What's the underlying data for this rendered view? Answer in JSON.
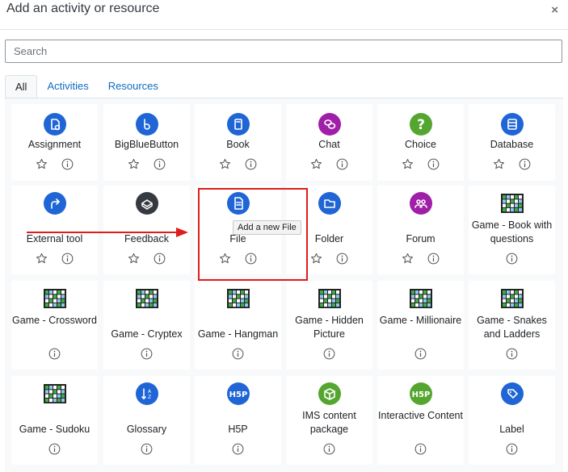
{
  "dialog": {
    "title": "Add an activity or resource",
    "close_glyph": "×"
  },
  "search": {
    "placeholder": "Search",
    "value": ""
  },
  "tabs": [
    {
      "label": "All",
      "active": true
    },
    {
      "label": "Activities",
      "active": false
    },
    {
      "label": "Resources",
      "active": false
    }
  ],
  "tooltip": {
    "text": "Add a new File"
  },
  "tiles": [
    {
      "label": "Assignment",
      "icon": "assignment-icon",
      "color": "#1f65d6",
      "starred": false
    },
    {
      "label": "BigBlueButton",
      "icon": "bigbluebutton-icon",
      "color": "#1f65d6",
      "starred": false
    },
    {
      "label": "Book",
      "icon": "book-icon",
      "color": "#1f65d6",
      "starred": false
    },
    {
      "label": "Chat",
      "icon": "chat-icon",
      "color": "#9f1fa8",
      "starred": false
    },
    {
      "label": "Choice",
      "icon": "choice-icon",
      "color": "#55a630",
      "starred": false
    },
    {
      "label": "Database",
      "icon": "database-icon",
      "color": "#1f65d6",
      "starred": false
    },
    {
      "label": "External tool",
      "icon": "external-tool-icon",
      "color": "#1f65d6",
      "starred": false
    },
    {
      "label": "Feedback",
      "icon": "feedback-icon",
      "color": "#343a40",
      "starred": false
    },
    {
      "label": "File",
      "icon": "file-icon",
      "color": "#1f65d6",
      "starred": false
    },
    {
      "label": "Folder",
      "icon": "folder-icon",
      "color": "#1f65d6",
      "starred": false
    },
    {
      "label": "Forum",
      "icon": "forum-icon",
      "color": "#9f1fa8",
      "starred": false
    },
    {
      "label": "Game - Book with questions",
      "icon": "game-board-icon",
      "color": "#222222",
      "starred": null
    },
    {
      "label": "Game - Crossword",
      "icon": "game-board-icon",
      "color": "#222222",
      "starred": null
    },
    {
      "label": "Game - Cryptex",
      "icon": "game-board-icon",
      "color": "#222222",
      "starred": null
    },
    {
      "label": "Game - Hangman",
      "icon": "game-board-icon",
      "color": "#222222",
      "starred": null
    },
    {
      "label": "Game - Hidden Picture",
      "icon": "game-board-icon",
      "color": "#222222",
      "starred": null
    },
    {
      "label": "Game - Millionaire",
      "icon": "game-board-icon",
      "color": "#222222",
      "starred": null
    },
    {
      "label": "Game - Snakes and Ladders",
      "icon": "game-board-icon",
      "color": "#222222",
      "starred": null
    },
    {
      "label": "Game - Sudoku",
      "icon": "game-board-icon",
      "color": "#222222",
      "starred": null
    },
    {
      "label": "Glossary",
      "icon": "glossary-icon",
      "color": "#1f65d6",
      "starred": null
    },
    {
      "label": "H5P",
      "icon": "h5p-icon",
      "color": "#1f65d6",
      "starred": null
    },
    {
      "label": "IMS content package",
      "icon": "ims-package-icon",
      "color": "#55a630",
      "starred": null
    },
    {
      "label": "Interactive Content",
      "icon": "h5p-icon",
      "color": "#55a630",
      "starred": null
    },
    {
      "label": "Label",
      "icon": "label-icon",
      "color": "#1f65d6",
      "starred": null
    }
  ]
}
